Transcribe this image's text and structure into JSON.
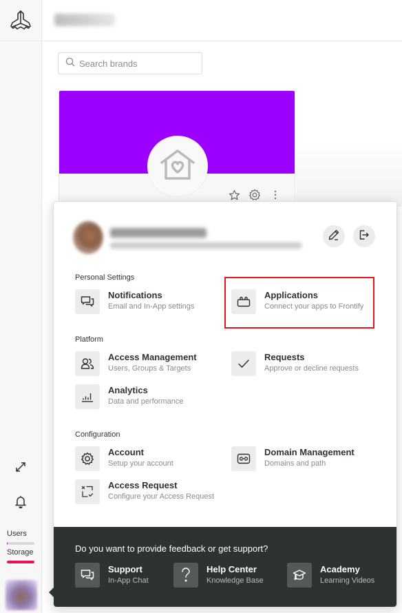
{
  "header": {
    "workspace_name_redacted": true
  },
  "search": {
    "placeholder": "Search brands",
    "value": ""
  },
  "brand_card": {
    "banner_color": "#9b00ff",
    "logo_icon": "house-heart-icon",
    "actions": [
      {
        "name": "favorite",
        "icon": "star-icon"
      },
      {
        "name": "settings",
        "icon": "gear-icon"
      },
      {
        "name": "more",
        "icon": "more-vertical-icon"
      }
    ]
  },
  "rail": {
    "logo_icon": "frontify-logo-icon",
    "expand_icon": "expand-icon",
    "notifications_icon": "bell-icon",
    "usage": [
      {
        "label": "Users",
        "percent": 3,
        "color": "#9b00ff"
      },
      {
        "label": "Storage",
        "percent": 100,
        "color": "#ee0f4c"
      }
    ]
  },
  "profile": {
    "name_redacted": true,
    "email_redacted": true,
    "edit_icon": "pencil-icon",
    "logout_icon": "logout-icon"
  },
  "sections": [
    {
      "title": "Personal Settings",
      "items": [
        {
          "title": "Notifications",
          "subtitle": "Email and In-App settings",
          "icon": "chat-bubbles-icon"
        },
        {
          "title": "Applications",
          "subtitle": "Connect your apps to Frontify",
          "icon": "applications-icon",
          "highlighted": true
        }
      ]
    },
    {
      "title": "Platform",
      "items": [
        {
          "title": "Access Management",
          "subtitle": "Users, Groups & Targets",
          "icon": "users-icon"
        },
        {
          "title": "Requests",
          "subtitle": "Approve or decline requests",
          "icon": "checkmark-icon"
        },
        {
          "title": "Analytics",
          "subtitle": "Data and performance",
          "icon": "bar-chart-icon"
        }
      ]
    },
    {
      "title": "Configuration",
      "items": [
        {
          "title": "Account",
          "subtitle": "Setup your account",
          "icon": "gear-icon"
        },
        {
          "title": "Domain Management",
          "subtitle": "Domains and path",
          "icon": "link-icon"
        },
        {
          "title": "Access Request",
          "subtitle": "Configure your Access Request",
          "icon": "access-request-icon"
        }
      ]
    }
  ],
  "footer": {
    "question": "Do you want to provide feedback or get support?",
    "items": [
      {
        "title": "Support",
        "subtitle": "In-App Chat",
        "icon": "chat-bubbles-icon"
      },
      {
        "title": "Help Center",
        "subtitle": "Knowledge Base",
        "icon": "question-mark-icon"
      },
      {
        "title": "Academy",
        "subtitle": "Learning Videos",
        "icon": "graduation-cap-icon"
      }
    ]
  },
  "colors": {
    "accent": "#9b00ff",
    "highlight": "#e4141b",
    "footer_bg": "#2d3232",
    "tile_bg": "#ececec"
  }
}
